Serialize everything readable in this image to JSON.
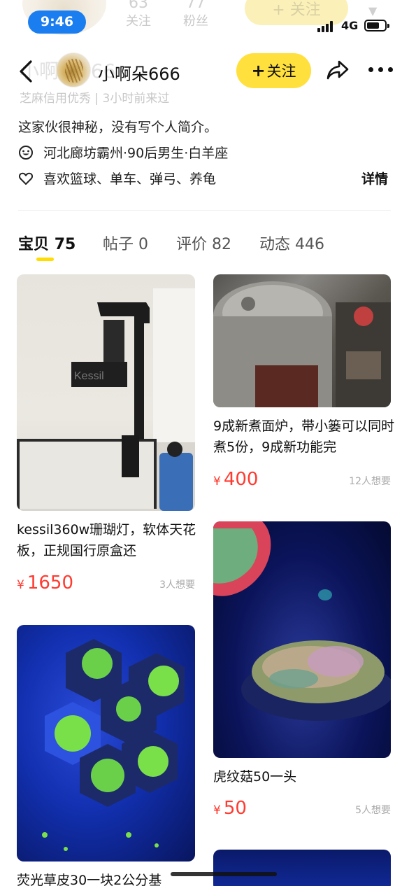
{
  "status_bar": {
    "time": "9:46",
    "network": "4G"
  },
  "background_header": {
    "name_partial": "小啊朵666",
    "stats": [
      {
        "num": "63",
        "label": "关注"
      },
      {
        "num": "77",
        "label": "粉丝"
      }
    ],
    "follow_label": "+ 关注",
    "subtitle": "芝麻信用优秀 | 3小时前来过"
  },
  "nav": {
    "username": "小啊朵666",
    "follow_label": "关注"
  },
  "profile": {
    "bio": "这家伙很神秘，没有写个人简介。",
    "location_line": "河北廊坊霸州·90后男生·白羊座",
    "hobbies_line": "喜欢篮球、单车、弹弓、养龟",
    "detail_label": "详情"
  },
  "tabs": [
    {
      "label": "宝贝",
      "count": "75"
    },
    {
      "label": "帖子",
      "count": "0"
    },
    {
      "label": "评价",
      "count": "82"
    },
    {
      "label": "动态",
      "count": "446"
    }
  ],
  "listings": [
    {
      "title": "kessil360w珊瑚灯，软体天花板，正规国行原盒还",
      "price": "1650",
      "wants": "3人想要",
      "image_text": "Kessil"
    },
    {
      "title": "9成新煮面炉，带小篓可以同时煮5份，9成新功能完",
      "price": "400",
      "wants": "12人想要"
    },
    {
      "title": "虎纹菇50一头",
      "price": "50",
      "wants": "5人想要"
    },
    {
      "title": "荧光草皮30一块2公分基"
    }
  ],
  "currency_symbol": "¥"
}
